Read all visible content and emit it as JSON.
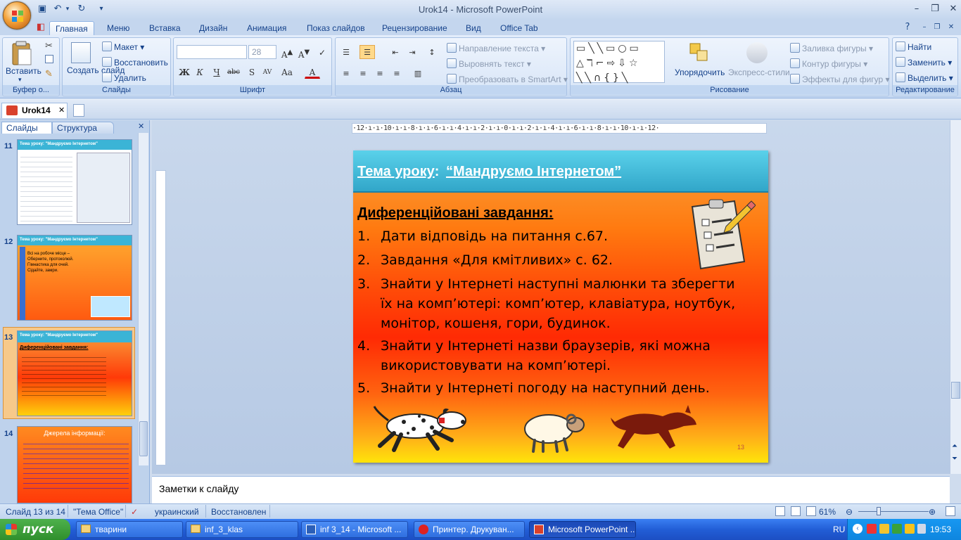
{
  "window": {
    "title": "Urok14 - Microsoft PowerPoint",
    "quick_access": [
      "save-icon",
      "undo-icon",
      "redo-icon"
    ]
  },
  "ribbon": {
    "tabs": [
      "Главная",
      "Меню",
      "Вставка",
      "Дизайн",
      "Анимация",
      "Показ слайдов",
      "Рецензирование",
      "Вид",
      "Office Tab"
    ],
    "active_tab": "Главная",
    "clipboard": {
      "paste": "Вставить",
      "label": "Буфер о..."
    },
    "slides": {
      "new_slide": "Создать слайд",
      "layout": "Макет",
      "reset": "Восстановить",
      "delete": "Удалить",
      "label": "Слайды"
    },
    "font": {
      "font_name": "",
      "font_size": "28",
      "label": "Шрифт",
      "buttons": [
        "Ж",
        "К",
        "Ч",
        "abc",
        "S",
        "AV",
        "Aa",
        "A"
      ]
    },
    "paragraph": {
      "text_direction": "Направление текста",
      "align_text": "Выровнять текст",
      "smartart": "Преобразовать в SmartArt",
      "label": "Абзац"
    },
    "drawing": {
      "arrange": "Упорядочить",
      "quick_styles": "Экспресс-стили",
      "fill": "Заливка фигуры",
      "outline": "Контур фигуры",
      "effects": "Эффекты для фигур",
      "label": "Рисование"
    },
    "editing": {
      "find": "Найти",
      "replace": "Заменить",
      "select": "Выделить",
      "label": "Редактирование"
    }
  },
  "doc_tab": {
    "name": "Urok14"
  },
  "left_pane": {
    "tabs": [
      "Слайды",
      "Структура"
    ],
    "thumbnails": [
      {
        "number": "11",
        "title": "Тема уроку: \"Мандруємо Інтернетом\""
      },
      {
        "number": "12",
        "title": "Тема уроку: \"Мандруємо Інтернетом\"",
        "text": "Всі на робоче місце – Оберните, протоколюй. Гімнастика для очей. Сідайте, замри."
      },
      {
        "number": "13",
        "title": "Тема уроку: \"Мандруємо Інтернетом\"",
        "heading": "Диференційовані завдання:"
      },
      {
        "number": "14",
        "title": "Джерела інформації:"
      }
    ]
  },
  "ruler": {
    "marks": "·12·ı·ı·10·ı·ı·8·ı·ı·6·ı·ı·4·ı·ı·2·ı·ı·0·ı·ı·2·ı·ı·4·ı·ı·6·ı·ı·8·ı·ı·10·ı·ı·12·"
  },
  "slide": {
    "title_prefix": "Тема уроку",
    "title_colon": ":",
    "title_topic": "“Мандруємо Інтернетом”",
    "heading": "Диференційовані завдання:",
    "items": [
      {
        "n": "1.",
        "text": "Дати відповідь на питання с.67."
      },
      {
        "n": "2.",
        "text": "Завдання «Для кмітливих» с. 62."
      },
      {
        "n": "3.",
        "text": "Знайти у Інтернеті наступні малюнки та зберегти їх на комп’ютері: комп’ютер, клавіатура, ноутбук, монітор, кошеня, гори, будинок."
      },
      {
        "n": "4.",
        "text": "Знайти у Інтернеті назви браузерів, які можна використовувати на комп’ютері."
      },
      {
        "n": "5.",
        "text": "Знайти у Інтернеті погоду на наступний день."
      }
    ],
    "page_number": "13",
    "colors": {
      "header": "#3bb4d6",
      "bg_top": "#f9a13c",
      "bg_mid": "#ff2a04",
      "bg_bottom": "#ffe40a"
    }
  },
  "notes": {
    "placeholder": "Заметки к слайду"
  },
  "status": {
    "slide_position": "Слайд 13 из 14",
    "theme": "\"Тема Office\"",
    "language": "украинский",
    "state": "Восстановлен",
    "zoom": "61%"
  },
  "taskbar": {
    "start": "пуск",
    "buttons": [
      "тварини",
      "inf_3_klas",
      "inf 3_14 - Microsoft ...",
      "Принтер. Друкуван...",
      "Microsoft PowerPoint ..."
    ],
    "active": "Microsoft PowerPoint ...",
    "lang": "RU",
    "time": "19:53"
  }
}
